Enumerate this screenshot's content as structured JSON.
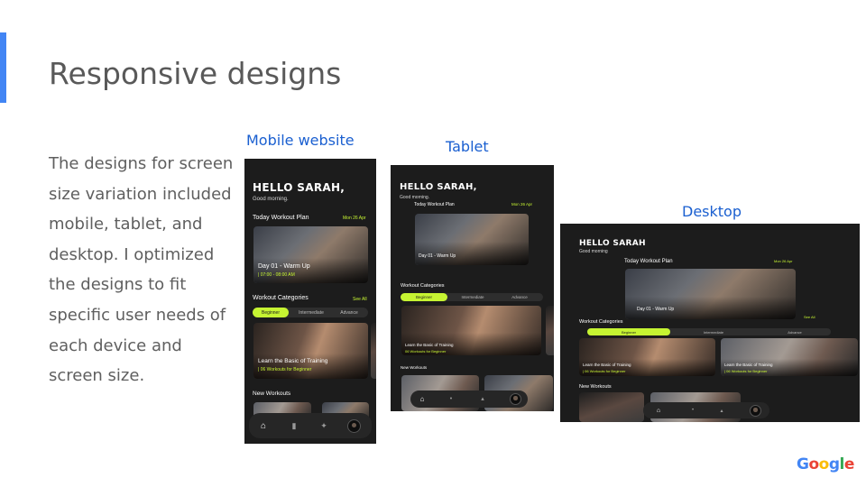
{
  "slide": {
    "title": "Responsive designs",
    "body": "The designs for screen size variation included mobile, tablet, and desktop. I optimized the designs to fit specific user needs of each device and screen size."
  },
  "captions": {
    "mobile": "Mobile website",
    "tablet": "Tablet",
    "desktop": "Desktop"
  },
  "mobile": {
    "greeting": "HELLO SARAH,",
    "subgreeting": "Good morning.",
    "plan_title": "Today Workout Plan",
    "plan_date": "Mon 26 Apr",
    "plan_item": "Day 01 - Warm Up",
    "plan_time": "| 07:00 - 08:00 AM",
    "categories_title": "Workout Categories",
    "see_all": "See All",
    "tabs": [
      "Beginner",
      "Intermediate",
      "Advance"
    ],
    "card_title": "Learn the Basic of Training",
    "card_sub": "| 06 Workouts  for Beginner",
    "new_workouts": "New Workouts",
    "nav_icons": [
      "home-icon",
      "chart-icon",
      "dumbbell-icon",
      "profile-icon"
    ]
  },
  "tablet": {
    "greeting": "HELLO SARAH,",
    "subgreeting": "Good morning.",
    "plan_title": "Today Workout Plan",
    "plan_date": "Mon 26 Apr",
    "plan_item": "Day 01 - Warm Up",
    "categories_title": "Workout Categories",
    "tabs": [
      "Beginner",
      "Intermediate",
      "Advance"
    ],
    "card_title": "Learn the Basic of Training",
    "card_sub": "06 Workouts for Beginner",
    "new_workouts": "New Workouts"
  },
  "desktop": {
    "greeting": "HELLO SARAH",
    "subgreeting": "Good morning",
    "plan_title": "Today Workout Plan",
    "plan_date": "Mon 26 Apr",
    "plan_item": "Day 01 - Warm Up",
    "see_all": "See All",
    "categories_title": "Workout Categories",
    "tabs": [
      "Beginner",
      "Intermediate",
      "Advance"
    ],
    "card_title": "Learn the Basic of Training",
    "card_sub": "| 06 Workouts for Beginner",
    "card2_title": "Learn the Basic of Training",
    "card2_sub": "| 06 Workouts for Beginner",
    "new_workouts": "New Workouts"
  },
  "logo": {
    "letters": [
      "G",
      "o",
      "o",
      "g",
      "l",
      "e"
    ]
  }
}
